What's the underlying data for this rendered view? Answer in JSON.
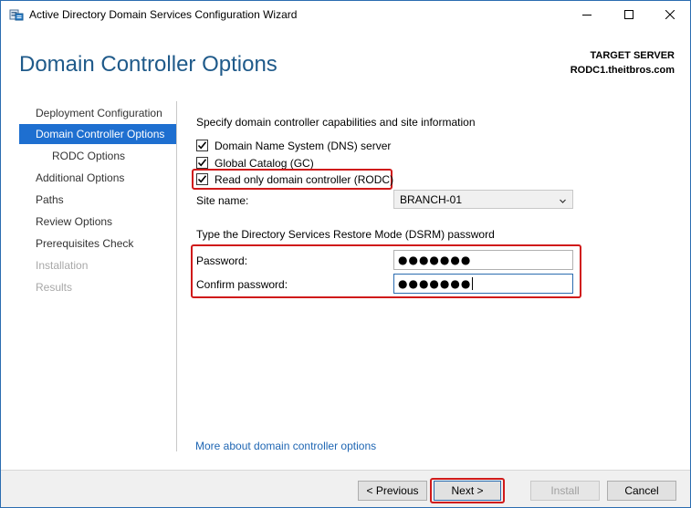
{
  "window": {
    "title": "Active Directory Domain Services Configuration Wizard"
  },
  "header": {
    "page_title": "Domain Controller Options",
    "target_label": "TARGET SERVER",
    "target_name": "RODC1.theitbros.com"
  },
  "nav": {
    "items": [
      {
        "label": "Deployment Configuration",
        "state": "normal"
      },
      {
        "label": "Domain Controller Options",
        "state": "active"
      },
      {
        "label": "RODC Options",
        "state": "sub"
      },
      {
        "label": "Additional Options",
        "state": "normal"
      },
      {
        "label": "Paths",
        "state": "normal"
      },
      {
        "label": "Review Options",
        "state": "normal"
      },
      {
        "label": "Prerequisites Check",
        "state": "normal"
      },
      {
        "label": "Installation",
        "state": "disabled"
      },
      {
        "label": "Results",
        "state": "disabled"
      }
    ]
  },
  "main": {
    "capabilities_heading": "Specify domain controller capabilities and site information",
    "dns_label": "Domain Name System (DNS) server",
    "gc_label": "Global Catalog (GC)",
    "rodc_label": "Read only domain controller (RODC)",
    "site_name_label": "Site name:",
    "site_name_value": "BRANCH-01",
    "dsrm_heading": "Type the Directory Services Restore Mode (DSRM) password",
    "password_label": "Password:",
    "password_value": "●●●●●●●",
    "confirm_label": "Confirm password:",
    "confirm_value": "●●●●●●●",
    "more_link": "More about domain controller options"
  },
  "footer": {
    "previous_label": "< Previous",
    "next_label": "Next >",
    "install_label": "Install",
    "cancel_label": "Cancel"
  },
  "colors": {
    "accent": "#1e6fd0",
    "title_blue": "#1f5a8a",
    "highlight_red": "#d01a1a",
    "link": "#1f66b3"
  },
  "icons": {
    "app": "server-wizard-icon",
    "minimize": "minimize-icon",
    "maximize": "maximize-icon",
    "close": "close-icon",
    "dropdown": "chevron-down-icon",
    "check": "checkmark-icon"
  }
}
